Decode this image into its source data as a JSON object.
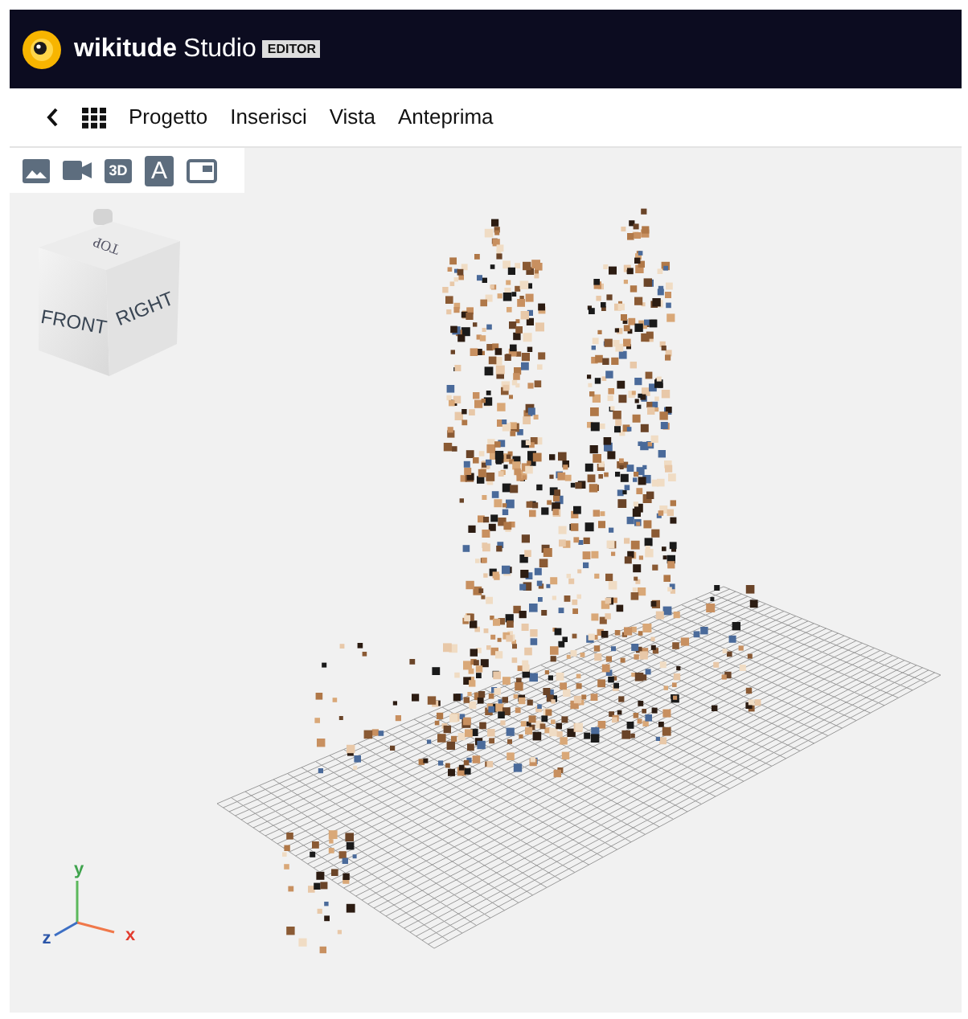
{
  "header": {
    "logo_text": "wikitude",
    "product": "Studio",
    "badge": "EDITOR"
  },
  "menu": {
    "items": [
      {
        "label": "Progetto"
      },
      {
        "label": "Inserisci"
      },
      {
        "label": "Vista"
      },
      {
        "label": "Anteprima"
      }
    ]
  },
  "toolbar": {
    "tools": [
      {
        "kind": "image"
      },
      {
        "kind": "video"
      },
      {
        "kind": "model",
        "label": "3D"
      },
      {
        "kind": "text",
        "label": "A"
      },
      {
        "kind": "overlay"
      }
    ]
  },
  "view_cube": {
    "top": "TOP",
    "front": "FRONT",
    "right": "RIGHT"
  },
  "axes": {
    "y": "y",
    "z": "z",
    "x": "x"
  }
}
